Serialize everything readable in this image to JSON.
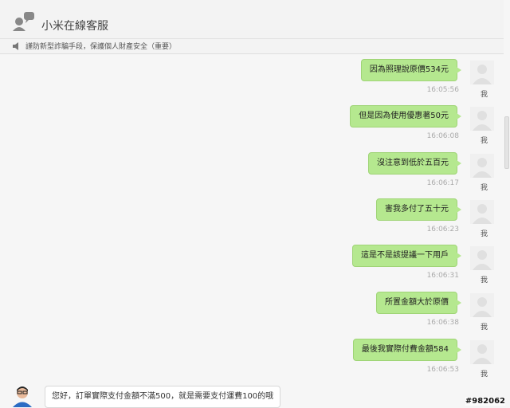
{
  "header": {
    "title": "小米在線客服",
    "logo_icon": "chat-bubble-person-icon"
  },
  "notice": {
    "icon": "speaker-icon",
    "text": "謹防新型詐騙手段，保護個人財產安全（重要）"
  },
  "messages": [
    {
      "text": "因為照理說原價534元",
      "time": "16:05:56",
      "sender_label": "我"
    },
    {
      "text": "但是因為使用優惠著50元",
      "time": "16:06:08",
      "sender_label": "我"
    },
    {
      "text": "沒注意到低於五百元",
      "time": "16:06:17",
      "sender_label": "我"
    },
    {
      "text": "害我多付了五十元",
      "time": "16:06:23",
      "sender_label": "我"
    },
    {
      "text": "這是不是該提議一下用戶",
      "time": "16:06:31",
      "sender_label": "我"
    },
    {
      "text": "所置金額大於原價",
      "time": "16:06:38",
      "sender_label": "我"
    },
    {
      "text": "最後我實際付費金額584",
      "time": "16:06:53",
      "sender_label": "我"
    }
  ],
  "agent_message": {
    "text": "您好，訂單實際支付金額不滿500，就是需要支付運費100的哦"
  },
  "watermark": "#982062",
  "colors": {
    "bubble_user": "#b5e88f",
    "bubble_agent": "#ffffff",
    "background": "#f6f6f6"
  }
}
